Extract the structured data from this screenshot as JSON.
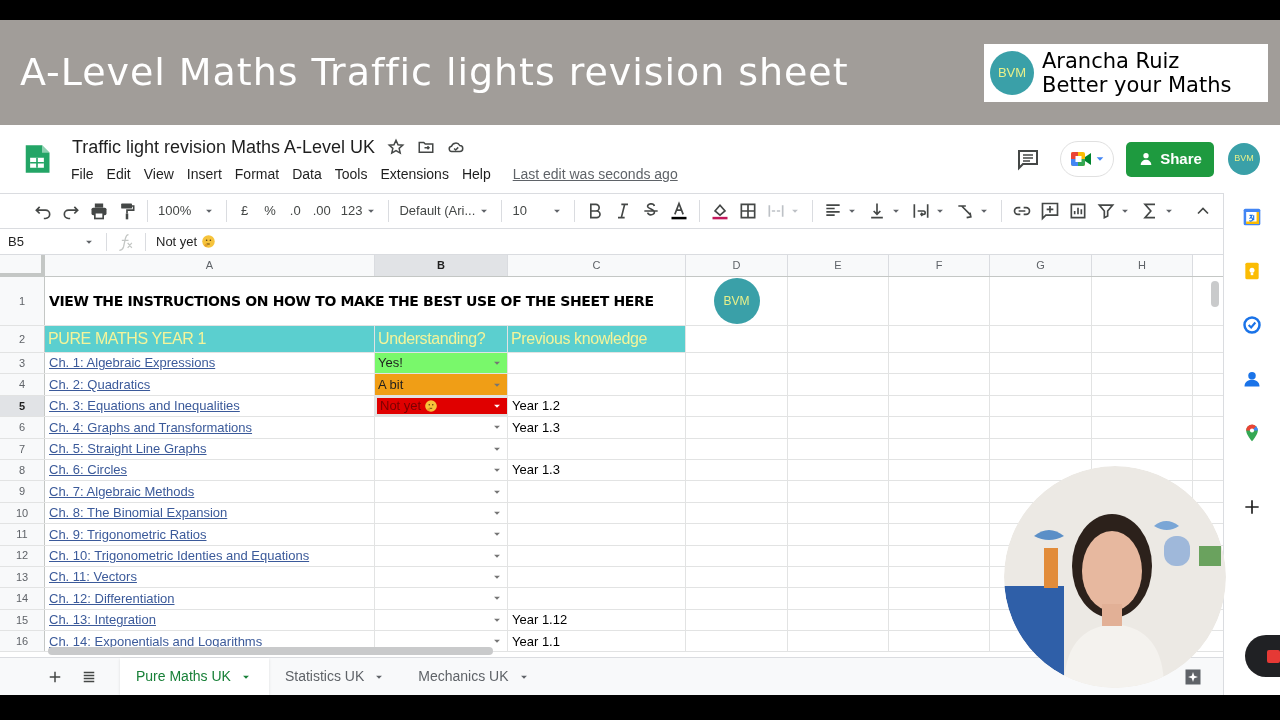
{
  "banner": {
    "title": "A-Level Maths Traffic lights revision sheet",
    "logo_text": "BVM",
    "logo_lines": [
      "Arancha Ruiz",
      "Better your Maths"
    ]
  },
  "document": {
    "title": "Traffic light revision Maths A-Level UK",
    "menu": [
      "File",
      "Edit",
      "View",
      "Insert",
      "Format",
      "Data",
      "Tools",
      "Extensions",
      "Help"
    ],
    "last_edit": "Last edit was seconds ago"
  },
  "share_button": "Share",
  "account_avatar": "BVM",
  "toolbar": {
    "zoom": "100%",
    "currency": "£",
    "percent": "%",
    "decrease_decimals": ".0",
    "increase_decimals": ".00",
    "number_format": "123",
    "font": "Default (Ari...",
    "font_size": "10"
  },
  "formula_bar": {
    "cell_ref": "B5",
    "value": "Not yet",
    "emoji": true
  },
  "columns": [
    {
      "label": "A",
      "selected": false
    },
    {
      "label": "B",
      "selected": true
    },
    {
      "label": "C",
      "selected": false
    },
    {
      "label": "D",
      "selected": false
    },
    {
      "label": "E",
      "selected": false
    },
    {
      "label": "F",
      "selected": false
    },
    {
      "label": "G",
      "selected": false
    },
    {
      "label": "H",
      "selected": false
    }
  ],
  "rows": [
    {
      "number": "1",
      "selected": false,
      "kind": "instructions",
      "a": "VIEW THE INSTRUCTIONS ON HOW TO MAKE THE BEST USE OF THE SHEET HERE",
      "d_logo": "BVM"
    },
    {
      "number": "2",
      "selected": false,
      "kind": "header",
      "a": "PURE MATHS YEAR 1",
      "b": "Understanding?",
      "c": "Previous knowledge"
    },
    {
      "number": "3",
      "selected": false,
      "kind": "topic",
      "a": "Ch. 1: Algebraic Expressions",
      "b": {
        "value": "Yes!",
        "color": "#79f86b",
        "selected": false
      }
    },
    {
      "number": "4",
      "selected": false,
      "kind": "topic",
      "a": "Ch. 2: Quadratics",
      "b": {
        "value": "A bit",
        "color": "#f09e16",
        "selected": false
      }
    },
    {
      "number": "5",
      "selected": true,
      "kind": "topic",
      "a": "Ch. 3: Equations and Inequalities",
      "b": {
        "value": "Not yet",
        "color": "#e00000",
        "selected": true,
        "emoji": true
      },
      "c": "Year 1.2"
    },
    {
      "number": "6",
      "selected": false,
      "kind": "topic",
      "a": "Ch. 4: Graphs and Transformations",
      "b": {
        "selected": false
      },
      "c": "Year 1.3"
    },
    {
      "number": "7",
      "selected": false,
      "kind": "topic",
      "a": "Ch. 5: Straight Line Graphs",
      "b": {
        "selected": false
      }
    },
    {
      "number": "8",
      "selected": false,
      "kind": "topic",
      "a": "Ch. 6: Circles",
      "b": {
        "selected": false
      },
      "c": "Year 1.3"
    },
    {
      "number": "9",
      "selected": false,
      "kind": "topic",
      "a": "Ch. 7: Algebraic Methods",
      "b": {
        "selected": false
      }
    },
    {
      "number": "10",
      "selected": false,
      "kind": "topic",
      "a": "Ch. 8: The Binomial Expansion",
      "b": {
        "selected": false
      }
    },
    {
      "number": "11",
      "selected": false,
      "kind": "topic",
      "a": "Ch. 9: Trigonometric Ratios",
      "b": {
        "selected": false
      }
    },
    {
      "number": "12",
      "selected": false,
      "kind": "topic",
      "a": "Ch. 10: Trigonometric Identies and Equations",
      "b": {
        "selected": false
      }
    },
    {
      "number": "13",
      "selected": false,
      "kind": "topic",
      "a": "Ch. 11: Vectors",
      "b": {
        "selected": false
      }
    },
    {
      "number": "14",
      "selected": false,
      "kind": "topic",
      "a": "Ch. 12: Differentiation",
      "b": {
        "selected": false
      }
    },
    {
      "number": "15",
      "selected": false,
      "kind": "topic",
      "a": "Ch. 13: Integration",
      "b": {
        "selected": false
      },
      "c": "Year 1.12"
    },
    {
      "number": "16",
      "selected": false,
      "kind": "topic",
      "a": "Ch. 14: Exponentials and Logarithms",
      "b": {
        "selected": false
      },
      "c": "Year 1.1"
    }
  ],
  "sheet_tabs": [
    {
      "label": "Pure Maths UK",
      "selected": true
    },
    {
      "label": "Statistics UK",
      "selected": false
    },
    {
      "label": "Mechanics UK",
      "selected": false
    }
  ]
}
